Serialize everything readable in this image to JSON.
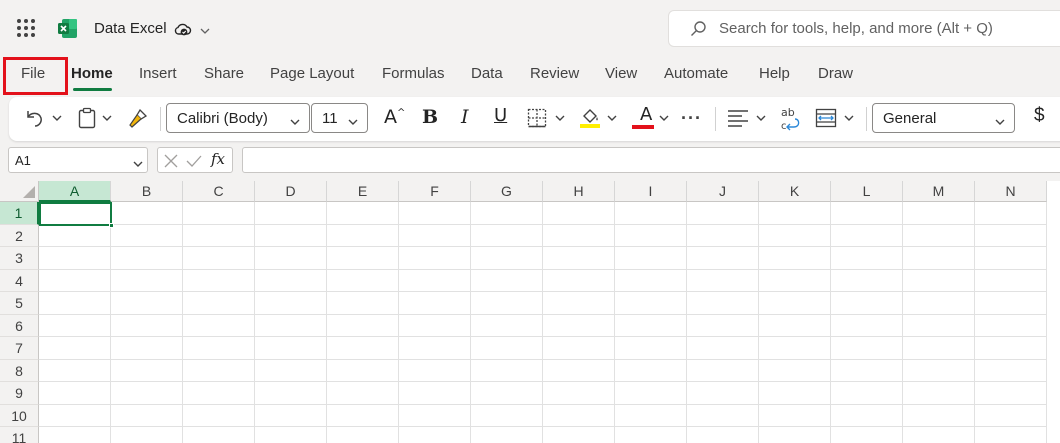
{
  "app": {
    "document_title": "Data Excel",
    "brand_color": "#107c41",
    "highlight_color": "#e3111b"
  },
  "search": {
    "placeholder": "Search for tools, help, and more (Alt + Q)"
  },
  "tabs": [
    {
      "label": "File",
      "name": "tab-file"
    },
    {
      "label": "Home",
      "name": "tab-home",
      "active": true
    },
    {
      "label": "Insert",
      "name": "tab-insert"
    },
    {
      "label": "Share",
      "name": "tab-share"
    },
    {
      "label": "Page Layout",
      "name": "tab-page-layout"
    },
    {
      "label": "Formulas",
      "name": "tab-formulas"
    },
    {
      "label": "Data",
      "name": "tab-data"
    },
    {
      "label": "Review",
      "name": "tab-review"
    },
    {
      "label": "View",
      "name": "tab-view"
    },
    {
      "label": "Automate",
      "name": "tab-automate"
    },
    {
      "label": "Help",
      "name": "tab-help"
    },
    {
      "label": "Draw",
      "name": "tab-draw"
    }
  ],
  "ribbon": {
    "font_name": "Calibri (Body)",
    "font_size": "11",
    "bold_label": "B",
    "italic_label": "I",
    "underline_label": "U",
    "grow_font_label": "A",
    "font_color_label": "A",
    "more_label": "···",
    "number_format": "General",
    "currency_label": "$",
    "fill_color": "#ffef00",
    "font_color": "#e3111b"
  },
  "formula_bar": {
    "name_box": "A1",
    "fx_label": "fx",
    "formula": ""
  },
  "sheet": {
    "columns": [
      "A",
      "B",
      "C",
      "D",
      "E",
      "F",
      "G",
      "H",
      "I",
      "J",
      "K",
      "L",
      "M",
      "N"
    ],
    "rows": [
      "1",
      "2",
      "3",
      "4",
      "5",
      "6",
      "7",
      "8",
      "9",
      "10",
      "11"
    ],
    "active_cell": "A1"
  }
}
